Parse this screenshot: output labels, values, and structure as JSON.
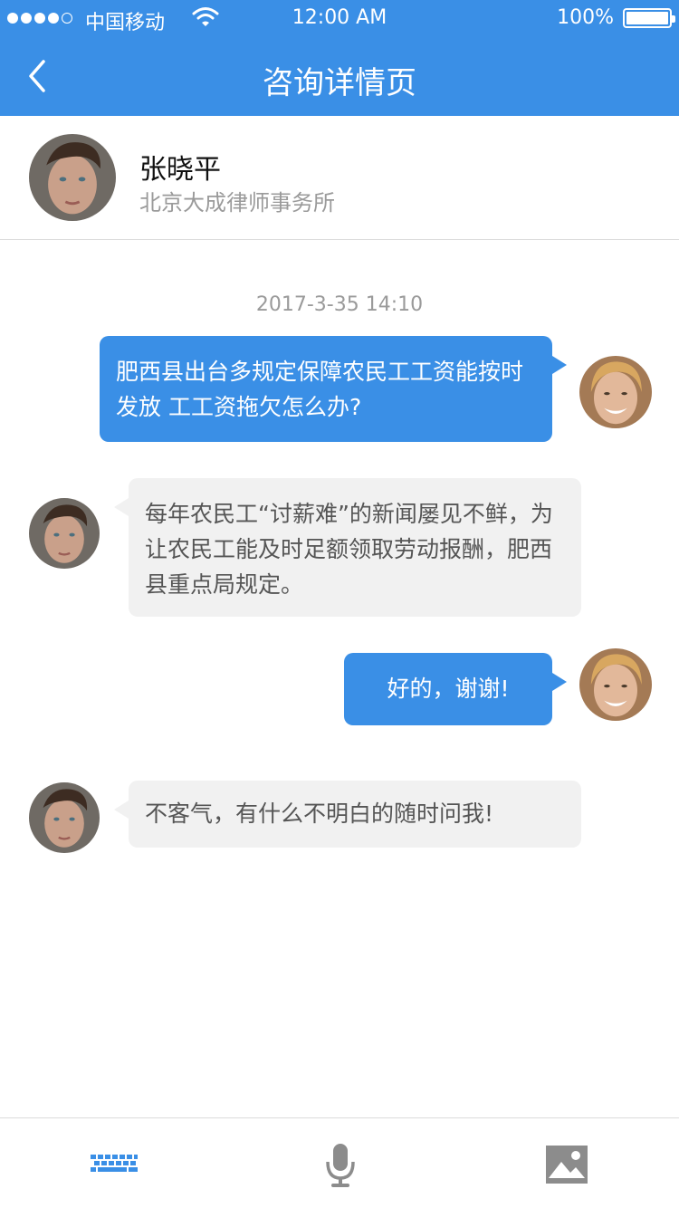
{
  "status_bar": {
    "carrier": "中国移动",
    "time": "12:00 AM",
    "battery": "100%"
  },
  "nav": {
    "title": "咨询详情页",
    "back_icon": "chevron-left-icon"
  },
  "lawyer": {
    "name": "张晓平",
    "firm": "北京大成律师事务所"
  },
  "chat": {
    "timestamp": "2017-3-35 14:10",
    "messages": [
      {
        "sender": "user",
        "text": "肥西县出台多规定保障农民工工资能按时发放 工工资拖欠怎么办?"
      },
      {
        "sender": "lawyer",
        "text": "每年农民工“讨薪难”的新闻屡见不鲜，为让农民工能及时足额领取劳动报酬，肥西县重点局规定。"
      },
      {
        "sender": "user",
        "text": "好的，谢谢!"
      },
      {
        "sender": "lawyer",
        "text": "不客气，有什么不明白的随时问我!"
      }
    ]
  },
  "toolbar": {
    "icons": [
      "keyboard-icon",
      "microphone-icon",
      "image-icon"
    ]
  },
  "colors": {
    "accent": "#3a8fe6",
    "bubble_incoming": "#f1f1f1",
    "muted_text": "#9a9a9a"
  }
}
